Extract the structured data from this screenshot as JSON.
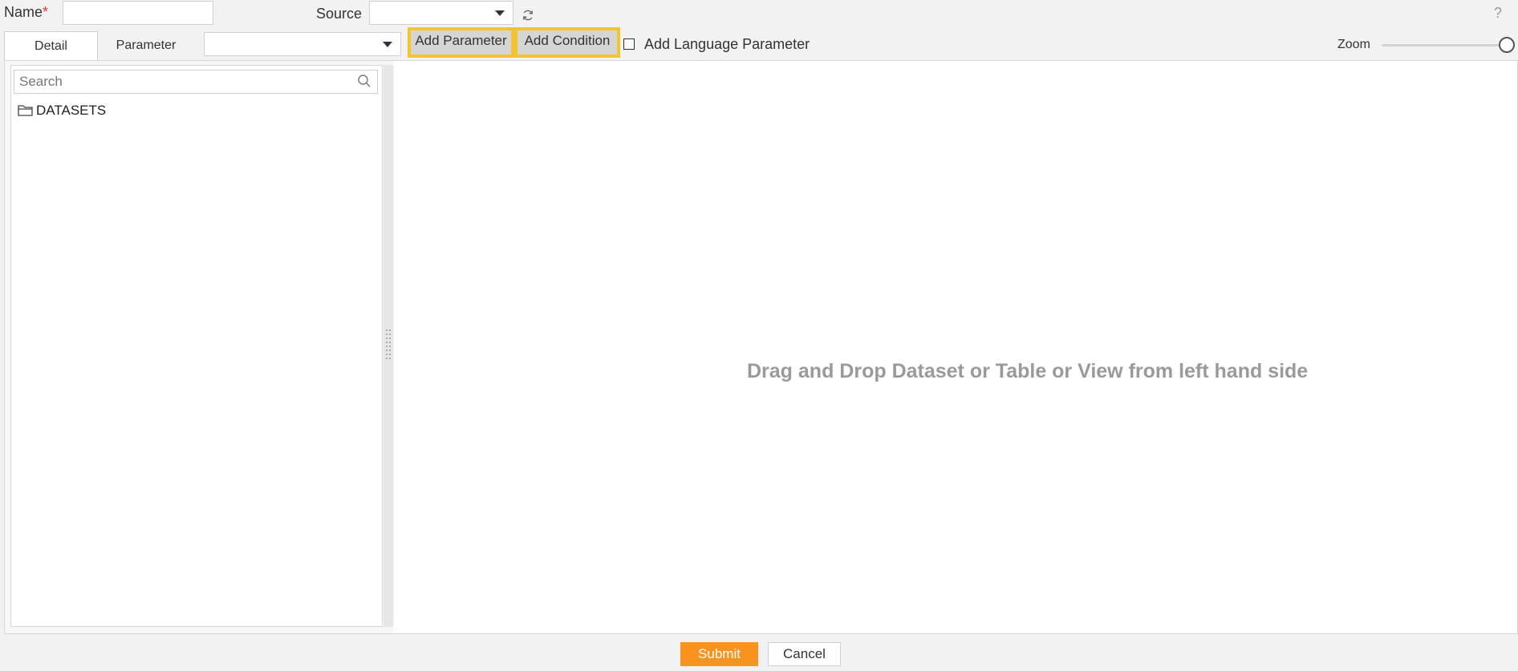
{
  "form": {
    "name_label": "Name",
    "name_required_mark": "*",
    "name_value": "",
    "source_label": "Source",
    "source_value": ""
  },
  "help_label": "?",
  "tabs": [
    {
      "label": "Detail",
      "active": true
    },
    {
      "label": "Parameter",
      "active": false
    }
  ],
  "parameter_select_value": "",
  "toolbar": {
    "add_parameter_label": "Add Parameter",
    "add_condition_label": "Add Condition",
    "add_language_parameter_label": "Add Language Parameter",
    "add_language_parameter_checked": false,
    "zoom_label": "Zoom",
    "zoom_level": 1.0
  },
  "tree": {
    "search_placeholder": "Search",
    "items": [
      {
        "label": "DATASETS",
        "icon": "folder-icon"
      }
    ]
  },
  "canvas": {
    "hint": "Drag and Drop Dataset or Table or View from left hand side"
  },
  "footer": {
    "submit_label": "Submit",
    "cancel_label": "Cancel"
  },
  "colors": {
    "highlight_border": "#f4c430",
    "submit_bg": "#f7931e",
    "required": "#e53935"
  }
}
